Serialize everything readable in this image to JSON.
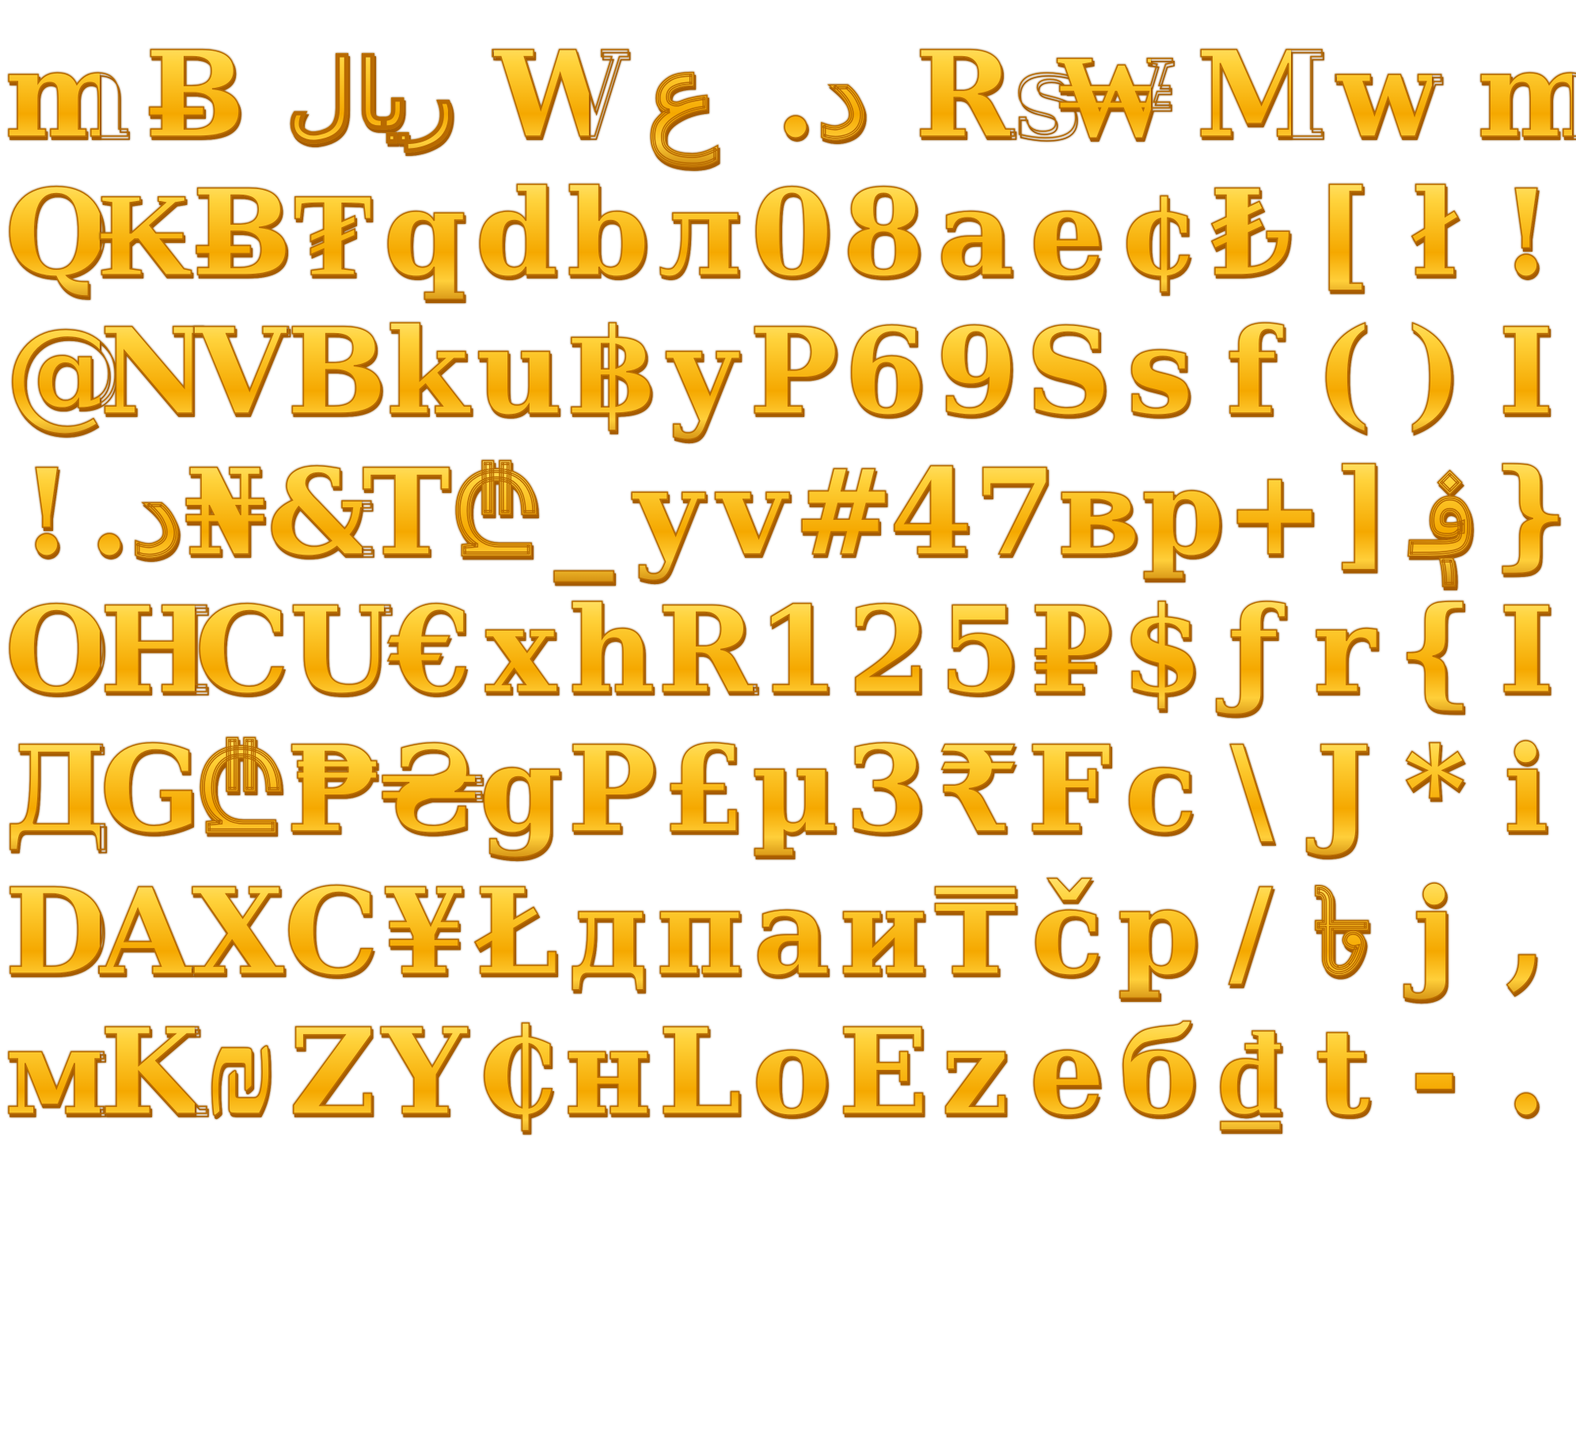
{
  "glyph_sheet": {
    "rows": [
      [
        "m",
        "Ƀ",
        "ريال",
        "W",
        "ع",
        ".د",
        "Rs",
        "₩",
        "M",
        "w",
        "m"
      ],
      [
        "Q",
        "₭",
        "Ƀ",
        "₮",
        "q",
        "d",
        "b",
        "л",
        "0",
        "8",
        "a",
        "e",
        "¢",
        "₺",
        "[",
        "ł",
        "!"
      ],
      [
        "@",
        "N",
        "V",
        "B",
        "k",
        "u",
        "฿",
        "y",
        "P",
        "6",
        "9",
        "S",
        "s",
        "f",
        "(",
        ")",
        "I"
      ],
      [
        "!",
        ".د",
        "₦",
        "&",
        "T",
        "₾",
        "_",
        "y",
        "v",
        "#",
        "4",
        "7",
        "в",
        "p",
        "+",
        "]",
        "؋",
        "}"
      ],
      [
        "O",
        "H",
        "C",
        "U",
        "€",
        "x",
        "h",
        "R",
        "1",
        "2",
        "5",
        "₽",
        "$",
        "ƒ",
        "r",
        "{",
        "I"
      ],
      [
        "Д",
        "G",
        "₾",
        "₱",
        "₴",
        "g",
        "P",
        "£",
        "µ",
        "3",
        "₹",
        "F",
        "c",
        "\\",
        "J",
        "*",
        "i"
      ],
      [
        "D",
        "A",
        "X",
        "C",
        "¥",
        "Ł",
        "д",
        "п",
        "а",
        "и",
        "₸",
        "č",
        "p",
        "/",
        "৳",
        "j",
        ","
      ],
      [
        "м",
        "K",
        "₪",
        "Z",
        "Y",
        "₵",
        "н",
        "L",
        "o",
        "E",
        "z",
        "e",
        "б",
        "₫",
        "t",
        "-",
        "."
      ]
    ]
  }
}
